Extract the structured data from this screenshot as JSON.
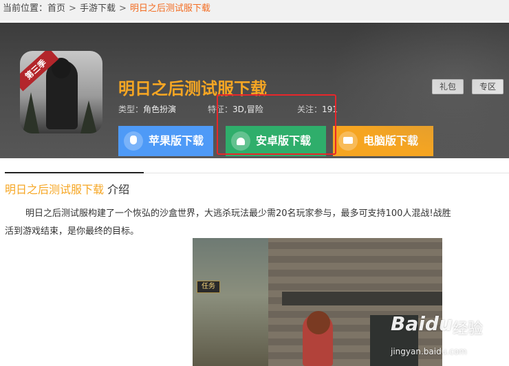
{
  "breadcrumb": {
    "label": "当前位置：",
    "home": "首页",
    "category": "手游下载",
    "current": "明日之后测试服下载",
    "sep": ">"
  },
  "app": {
    "icon_badge": "第三季",
    "title": "明日之后测试服下载",
    "type_label": "类型：",
    "type_value": "角色扮演",
    "feature_label": "特征：",
    "feature_value": "3D,冒险",
    "follow_label": "关注：",
    "follow_value": "191",
    "tags": [
      "礼包",
      "专区"
    ]
  },
  "downloads": {
    "apple": "苹果版下载",
    "android": "安卓版下载",
    "pc": "电脑版下载"
  },
  "intro": {
    "title_em": "明日之后测试服下载",
    "title_plain": " 介绍",
    "line1": "明日之后测试服构建了一个恢弘的沙盒世界，大逃杀玩法最少需20名玩家参与，最多可支持100人混战!战胜",
    "line2": "活到游戏结束，是你最终的目标。"
  },
  "screenshot": {
    "task_label": "任务"
  },
  "watermark": {
    "brand": "Baidu",
    "cn": "经验",
    "site": "jingyan.baidu.com"
  },
  "colors": {
    "accent_orange": "#f6a623",
    "apple_blue": "#4e9af7",
    "android_green": "#2fae6b",
    "pc_orange": "#f6a521",
    "highlight_red": "#e8262a"
  }
}
